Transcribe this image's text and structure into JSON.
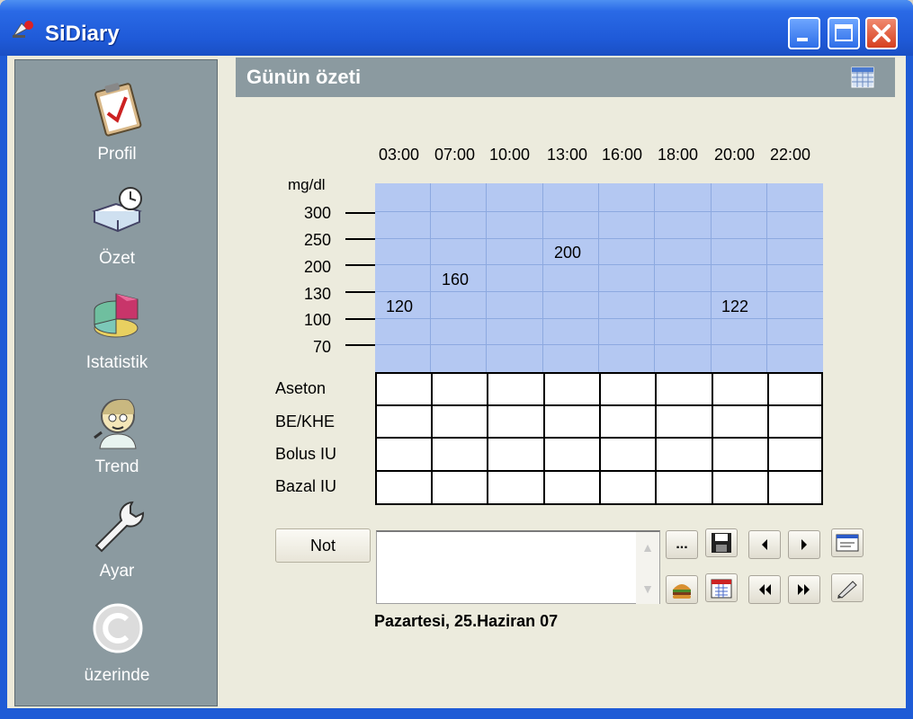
{
  "window": {
    "title": "SiDiary"
  },
  "sidebar": {
    "items": [
      {
        "label": "Profil",
        "icon": "clipboard-check-icon"
      },
      {
        "label": "Özet",
        "icon": "book-clock-icon"
      },
      {
        "label": "Istatistik",
        "icon": "pie-chart-icon"
      },
      {
        "label": "Trend",
        "icon": "doctor-icon"
      },
      {
        "label": "Ayar",
        "icon": "wrench-icon"
      },
      {
        "label": "üzerinde",
        "icon": "copyright-icon"
      }
    ]
  },
  "header": {
    "title": "Günün özeti"
  },
  "chart_data": {
    "type": "table",
    "unit_label": "mg/dl",
    "times": [
      "03:00",
      "07:00",
      "10:00",
      "13:00",
      "16:00",
      "18:00",
      "20:00",
      "22:00"
    ],
    "y_ticks": [
      "300",
      "250",
      "200",
      "130",
      "100",
      "70"
    ],
    "readings": [
      {
        "time": "03:00",
        "value": "120"
      },
      {
        "time": "07:00",
        "value": "160"
      },
      {
        "time": "13:00",
        "value": "200"
      },
      {
        "time": "20:00",
        "value": "122"
      }
    ],
    "row_labels": [
      "Aseton",
      "BE/KHE",
      "Bolus IU",
      "Bazal IU"
    ]
  },
  "controls": {
    "note_button": "Not",
    "more_button": "...",
    "note_text": "",
    "date": "Pazartesi, 25.Haziran 07"
  },
  "colors": {
    "plot_background": "#b4c8f2",
    "titlebar": "#1f5ad8",
    "sidebar": "#8b9aa0"
  }
}
